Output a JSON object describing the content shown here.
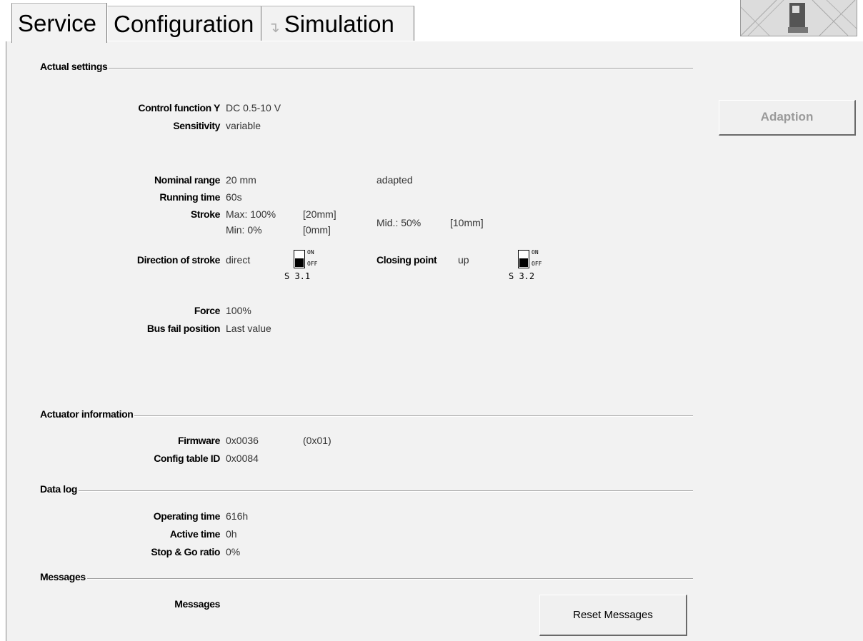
{
  "tabs": [
    {
      "label": "Service",
      "active": true
    },
    {
      "label": "Configuration",
      "active": false
    },
    {
      "label": "Simulation",
      "active": false,
      "icon": "chart-icon"
    }
  ],
  "actual_settings": {
    "header": "Actual settings",
    "control_function": {
      "label": "Control function Y",
      "value": "DC 0.5-10 V"
    },
    "sensitivity": {
      "label": "Sensitivity",
      "value": "variable"
    },
    "nominal_range": {
      "label": "Nominal range",
      "value": "20 mm",
      "status": "adapted"
    },
    "running_time": {
      "label": "Running time",
      "value": "60s"
    },
    "stroke": {
      "label": "Stroke",
      "max": "Max: 100%",
      "max_mm": "[20mm]",
      "min": "Min: 0%",
      "min_mm": "[0mm]",
      "mid": "Mid.: 50%",
      "mid_mm": "[10mm]"
    },
    "direction": {
      "label": "Direction of stroke",
      "value": "direct",
      "switch_on": "ON",
      "switch_off": "OFF",
      "switch_id": "S 3.1",
      "switch_state": "OFF"
    },
    "closing_point": {
      "label": "Closing point",
      "value": "up",
      "switch_on": "ON",
      "switch_off": "OFF",
      "switch_id": "S 3.2",
      "switch_state": "OFF"
    },
    "force": {
      "label": "Force",
      "value": "100%"
    },
    "bus_fail": {
      "label": "Bus fail position",
      "value": "Last value"
    }
  },
  "adaption_button": "Adaption",
  "actuator_info": {
    "header": "Actuator information",
    "firmware": {
      "label": "Firmware",
      "value": "0x0036",
      "extra": "(0x01)"
    },
    "config_table": {
      "label": "Config table ID",
      "value": "0x0084"
    }
  },
  "data_log": {
    "header": "Data log",
    "operating_time": {
      "label": "Operating time",
      "value": "616h"
    },
    "active_time": {
      "label": "Active time",
      "value": "0h"
    },
    "stop_go": {
      "label": "Stop & Go ratio",
      "value": "0%"
    }
  },
  "messages": {
    "header": "Messages",
    "label": "Messages",
    "reset_button": "Reset Messages"
  }
}
